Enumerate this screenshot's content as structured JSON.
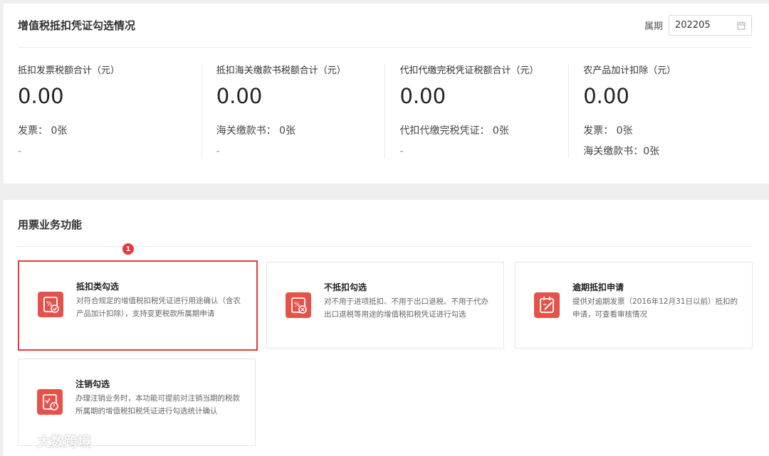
{
  "top": {
    "title": "增值税抵扣凭证勾选情况",
    "period_label": "属期",
    "period_value": "202205"
  },
  "stats": [
    {
      "label": "抵扣发票税额合计（元）",
      "value": "0.00",
      "lines": [
        "发票： 0张",
        "-"
      ]
    },
    {
      "label": "抵扣海关缴款书税额合计（元）",
      "value": "0.00",
      "lines": [
        "海关缴款书： 0张",
        "-"
      ]
    },
    {
      "label": "代扣代缴完税凭证税额合计（元）",
      "value": "0.00",
      "lines": [
        "代扣代缴完税凭证： 0张",
        "-"
      ]
    },
    {
      "label": "农产品加计扣除（元）",
      "value": "0.00",
      "lines": [
        "发票： 0张",
        "海关缴款书：0张"
      ]
    }
  ],
  "bottom": {
    "title": "用票业务功能",
    "badge": "1"
  },
  "cards": [
    {
      "title": "抵扣类勾选",
      "desc": "对符合规定的增值税扣税凭证进行用途确认（含农产品加计扣除），支持变更税款所属期申请",
      "icon": "deduction-check-icon"
    },
    {
      "title": "不抵扣勾选",
      "desc": "对不用于进项抵扣、不用于出口退税、不用于代办出口退税等用途的增值税扣税凭证进行勾选",
      "icon": "non-deduction-icon"
    },
    {
      "title": "逾期抵扣申请",
      "desc": "提供对逾期发票（2016年12月31日以前）抵扣的申请，可查看审核情况",
      "icon": "overdue-edit-icon"
    },
    {
      "title": "注销勾选",
      "desc": "办理注销业务时，本功能可提前对注销当期的税款所属期的增值税扣税凭证进行勾选统计确认",
      "icon": "cancel-power-icon"
    }
  ],
  "watermark": {
    "text": "大数跨境"
  },
  "colors": {
    "accent": "#e33b3b",
    "icon_bg": "#e6524a"
  }
}
